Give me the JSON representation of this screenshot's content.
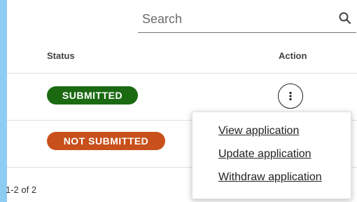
{
  "search": {
    "placeholder": "Search"
  },
  "table": {
    "columns": {
      "status": "Status",
      "action": "Action"
    },
    "rows": [
      {
        "status": "SUBMITTED",
        "status_color": "#1b6a12"
      },
      {
        "status": "NOT SUBMITTED",
        "status_color": "#c8501b"
      }
    ],
    "pagination": "1-2 of 2"
  },
  "action_menu": {
    "items": [
      "View application",
      "Update application",
      "Withdraw application"
    ]
  },
  "icons": [
    "search-icon",
    "more-vertical-icon"
  ]
}
